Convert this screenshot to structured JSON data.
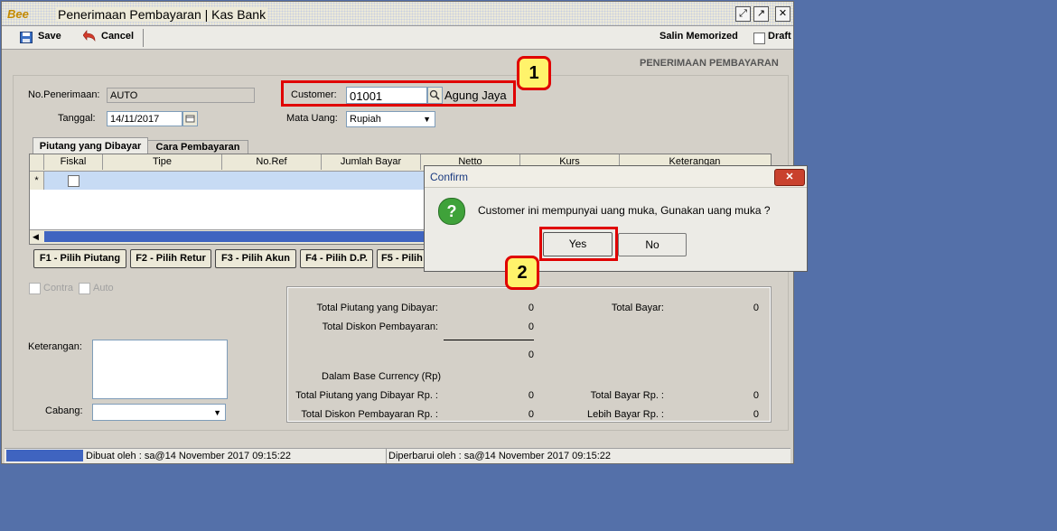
{
  "window": {
    "logo_text": "Bee",
    "title": "Penerimaan Pembayaran | Kas Bank",
    "buttons": {
      "restore": "⤢",
      "maximize": "↗",
      "close": "✕"
    }
  },
  "toolbar": {
    "save_label": "Save",
    "cancel_label": "Cancel",
    "salin_label": "Salin Memorized",
    "draft_label": "Draft"
  },
  "form": {
    "section_title": "PENERIMAAN PEMBAYARAN",
    "no_label": "No.Penerimaan:",
    "no_value": "AUTO",
    "tanggal_label": "Tanggal:",
    "tanggal_value": "14/11/2017",
    "customer_label": "Customer:",
    "customer_value": "01001",
    "customer_name": "Agung Jaya",
    "mata_uang_label": "Mata Uang:",
    "mata_uang_value": "Rupiah"
  },
  "tabs": [
    {
      "label": "Piutang yang Dibayar",
      "active": true
    },
    {
      "label": "Cara Pembayaran",
      "active": false
    }
  ],
  "table": {
    "row_marker": "*",
    "columns": [
      "Fiskal",
      "Tipe",
      "No.Ref",
      "Jumlah Bayar",
      "Netto",
      "Kurs",
      "Keterangan"
    ]
  },
  "fbuttons": [
    "F1 - Pilih Piutang",
    "F2 - Pilih Retur",
    "F3 - Pilih Akun",
    "F4 - Pilih D.P.",
    "F5 - Pilih"
  ],
  "options": {
    "contra": "Contra",
    "auto": "Auto"
  },
  "keterangan_label": "Keterangan:",
  "cabang_label": "Cabang:",
  "summary": {
    "total_piutang_label": "Total Piutang yang Dibayar:",
    "total_piutang_value": "0",
    "total_diskon_label": "Total Diskon Pembayaran:",
    "total_diskon_value": "0",
    "subtotal_value": "0",
    "total_bayar_label": "Total Bayar:",
    "total_bayar_value": "0",
    "base_currency_label": "Dalam Base Currency (Rp)",
    "total_piutang_rp_label": "Total Piutang yang Dibayar Rp. :",
    "total_piutang_rp_value": "0",
    "total_diskon_rp_label": "Total Diskon Pembayaran Rp. :",
    "total_diskon_rp_value": "0",
    "total_bayar_rp_label": "Total Bayar Rp. :",
    "total_bayar_rp_value": "0",
    "lebih_bayar_rp_label": "Lebih Bayar Rp. :",
    "lebih_bayar_rp_value": "0"
  },
  "status": {
    "dibuat": "Dibuat oleh : sa@14 November 2017  09:15:22",
    "diperbarui": "Diperbarui oleh : sa@14 November 2017  09:15:22"
  },
  "dialog": {
    "title": "Confirm",
    "message": "Customer ini mempunyai uang muka, Gunakan uang muka ?",
    "yes_label": "Yes",
    "no_label": "No",
    "question_glyph": "?",
    "close_glyph": "✕"
  },
  "annotations": {
    "badge1": "1",
    "badge2": "2"
  },
  "colors": {
    "desktop": "#5470a9",
    "row_selected": "#c7dbf4",
    "annotation_red": "#e00000",
    "badge_yellow": "#fff36b"
  }
}
